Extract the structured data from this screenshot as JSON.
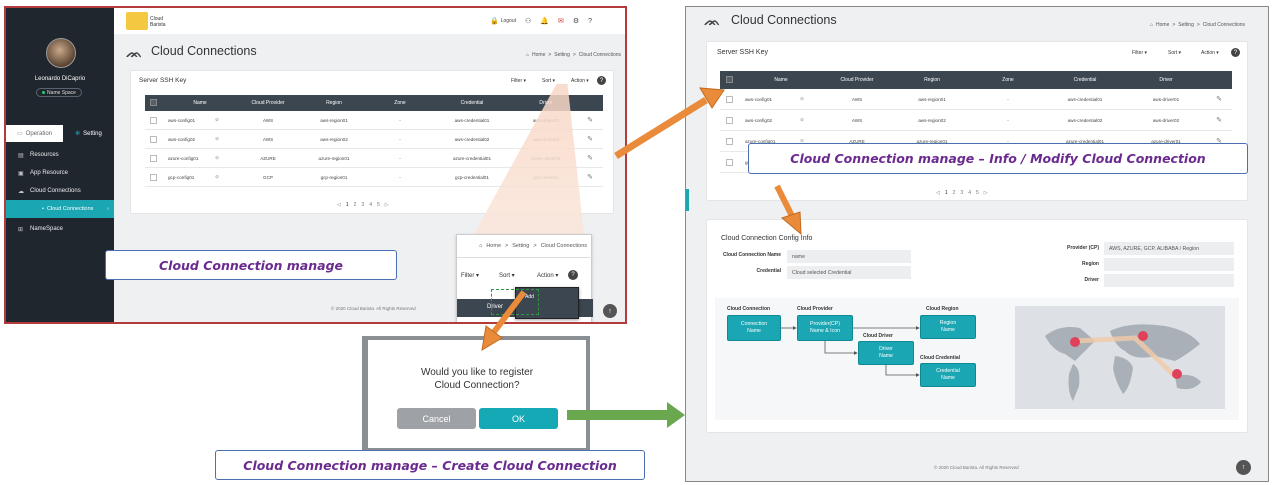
{
  "app": {
    "logo_line1": "Cloud",
    "logo_line2": "Barista",
    "logout": "Logout"
  },
  "user": {
    "name": "Leonardo DiCaprio",
    "namespace_badge": "Name Space"
  },
  "sidebar": {
    "tabs": [
      {
        "label": "Operation"
      },
      {
        "label": "Setting"
      }
    ],
    "items": [
      {
        "label": "Resources"
      },
      {
        "label": "App Resource"
      },
      {
        "label": "Cloud Connections"
      },
      {
        "label": "Cloud Connections"
      },
      {
        "label": "NameSpace"
      }
    ]
  },
  "page": {
    "title": "Cloud Connections",
    "breadcrumb": [
      "Home",
      "Setting",
      "Cloud Connections"
    ]
  },
  "card": {
    "title": "Server SSH Key",
    "filter": "Filter",
    "sort": "Sort",
    "action": "Action"
  },
  "table": {
    "columns": [
      "Name",
      "Cloud Provider",
      "Region",
      "Zone",
      "Credential",
      "Driver"
    ],
    "rows": [
      {
        "name": "aws-config01",
        "provider": "AWS",
        "region": "aws-region01",
        "zone": "-",
        "credential": "aws-credential01",
        "driver": "aws-driver01"
      },
      {
        "name": "aws-config02",
        "provider": "AWS",
        "region": "aws-region02",
        "zone": "-",
        "credential": "aws-credential02",
        "driver": "aws-driver02"
      },
      {
        "name": "azure-config01",
        "provider": "AZURE",
        "region": "azure-region01",
        "zone": "-",
        "credential": "azure-credential01",
        "driver": "azure-driver01"
      },
      {
        "name": "gcp-config01",
        "provider": "GCP",
        "region": "gcp-region01",
        "zone": "-",
        "credential": "gcp-credential01",
        "driver": "gcp-driver01"
      }
    ]
  },
  "pagination": {
    "pages": [
      "1",
      "2",
      "3",
      "4",
      "5"
    ]
  },
  "footer": {
    "copyright": "© 2020 Cloud Barista. All Rights Reserved"
  },
  "zoom": {
    "add": "Add",
    "driver": "Driver"
  },
  "dialog": {
    "message_line1": "Would you like to register",
    "message_line2": "Cloud Connection?",
    "cancel": "Cancel",
    "ok": "OK"
  },
  "captions": {
    "manage": "Cloud Connection manage",
    "create": "Cloud Connection manage – Create Cloud Connection",
    "info": "Cloud Connection manage – Info / Modify Cloud Connection"
  },
  "config_info": {
    "title": "Cloud Connection Config Info",
    "name_label": "Cloud Connection Name",
    "name_value": "name",
    "credential_label": "Credential",
    "credential_value": "Cloud selected Credential",
    "provider_label": "Provider (CP)",
    "provider_value": "AWS, AZURE, GCP, ALIBABA / Region",
    "region_label": "Region",
    "driver_label": "Driver"
  },
  "flow": {
    "connection_hdr": "Cloud Connection",
    "connection_box": [
      "Connection",
      "Name"
    ],
    "provider_hdr": "Cloud Provider",
    "provider_box": [
      "Provider(CP)",
      "Name & Icon"
    ],
    "region_hdr": "Cloud Region",
    "region_box": [
      "Region",
      "Name"
    ],
    "driver_hdr": "Cloud Driver",
    "driver_box": [
      "Driver",
      "Name"
    ],
    "credential_hdr": "Cloud Credential",
    "credential_box": [
      "Credential",
      "Name"
    ]
  },
  "colors": {
    "accent": "#1aa6b3",
    "sidebar": "#20262d",
    "header": "#3c4650",
    "arrow": "#e98b3a",
    "arrow_green": "#6aa84f",
    "caption_text": "#6a2a8f"
  }
}
